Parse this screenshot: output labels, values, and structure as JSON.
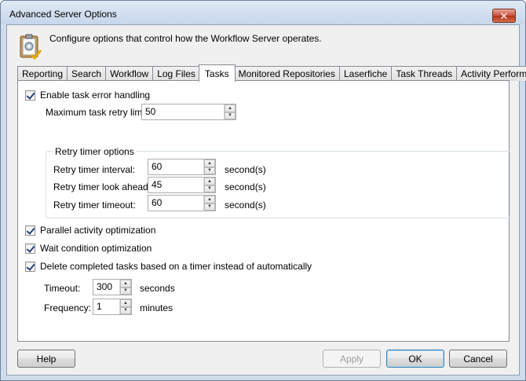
{
  "window": {
    "title": "Advanced Server Options"
  },
  "header": {
    "description": "Configure options that control how the Workflow Server operates.",
    "icon": "clipboard-gear-icon"
  },
  "tabs": [
    {
      "label": "Reporting",
      "active": false
    },
    {
      "label": "Search",
      "active": false
    },
    {
      "label": "Workflow",
      "active": false
    },
    {
      "label": "Log Files",
      "active": false
    },
    {
      "label": "Tasks",
      "active": true
    },
    {
      "label": "Monitored Repositories",
      "active": false
    },
    {
      "label": "Laserfiche",
      "active": false
    },
    {
      "label": "Task Threads",
      "active": false
    },
    {
      "label": "Activity Performance",
      "active": false
    }
  ],
  "tasks": {
    "enable_error_handling": {
      "label": "Enable task error handling",
      "checked": true
    },
    "max_retry": {
      "label": "Maximum task retry limit:",
      "value": "50"
    },
    "retry_group": {
      "title": "Retry timer options",
      "interval": {
        "label": "Retry timer interval:",
        "value": "60",
        "unit": "second(s)"
      },
      "look_ahead": {
        "label": "Retry timer look ahead:",
        "value": "45",
        "unit": "second(s)"
      },
      "timeout": {
        "label": "Retry timer timeout:",
        "value": "60",
        "unit": "second(s)"
      }
    },
    "parallel": {
      "label": "Parallel activity optimization",
      "checked": true
    },
    "wait": {
      "label": "Wait condition optimization",
      "checked": true
    },
    "delete_completed": {
      "label": "Delete completed tasks based on a timer instead of automatically",
      "checked": true
    },
    "timeout": {
      "label": "Timeout:",
      "value": "300",
      "unit": "seconds"
    },
    "frequency": {
      "label": "Frequency:",
      "value": "1",
      "unit": "minutes"
    }
  },
  "buttons": {
    "help": "Help",
    "apply": "Apply",
    "ok": "OK",
    "cancel": "Cancel"
  }
}
